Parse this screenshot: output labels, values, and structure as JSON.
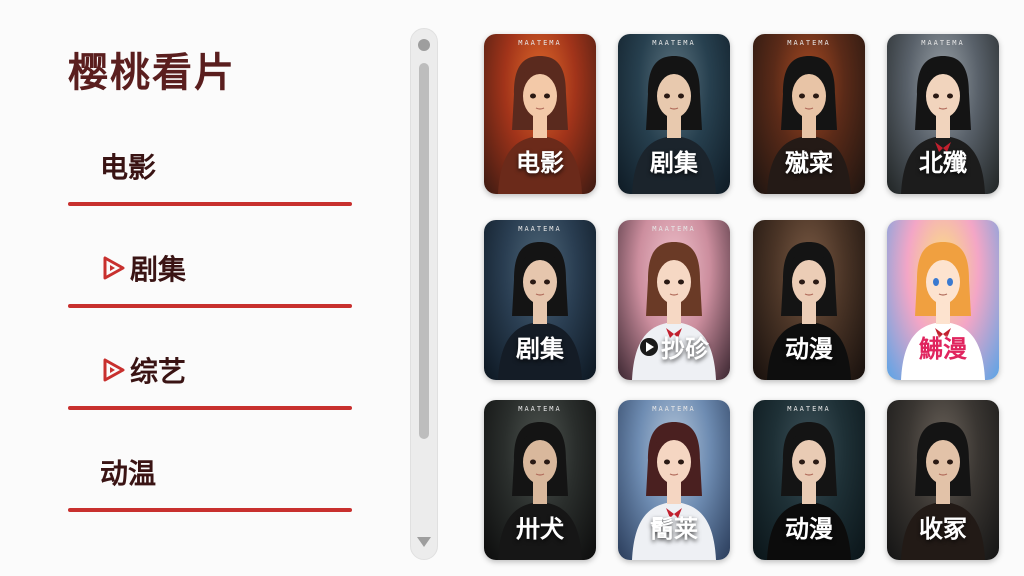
{
  "app": {
    "title": "樱桃看片"
  },
  "sidebar": {
    "items": [
      {
        "label": "电影",
        "icon": ""
      },
      {
        "label": "剧集",
        "icon": "play-badge-icon"
      },
      {
        "label": "综艺",
        "icon": "play-badge-icon"
      },
      {
        "label": "动温",
        "icon": ""
      }
    ]
  },
  "posters": [
    {
      "brand": "MAATEMA",
      "caption": "电影"
    },
    {
      "brand": "MAATEMA",
      "caption": "剧集"
    },
    {
      "brand": "MAATEMA",
      "caption": "殧寀"
    },
    {
      "brand": "MAATEMA",
      "caption": "北殲"
    },
    {
      "brand": "MAATEMA",
      "caption": "剧集"
    },
    {
      "brand": "MAATEMA",
      "caption": "抄䂦"
    },
    {
      "brand": "",
      "caption": "动漫"
    },
    {
      "brand": "",
      "caption": "鮄漫"
    },
    {
      "brand": "MAATEMA",
      "caption": "卅犬"
    },
    {
      "brand": "MAATEMA",
      "caption": "鬝莱"
    },
    {
      "brand": "MAATEMA",
      "caption": "动漫"
    },
    {
      "brand": "",
      "caption": "收冢"
    }
  ],
  "colors": {
    "accent": "#c8302e",
    "title": "#5a1e1e"
  }
}
